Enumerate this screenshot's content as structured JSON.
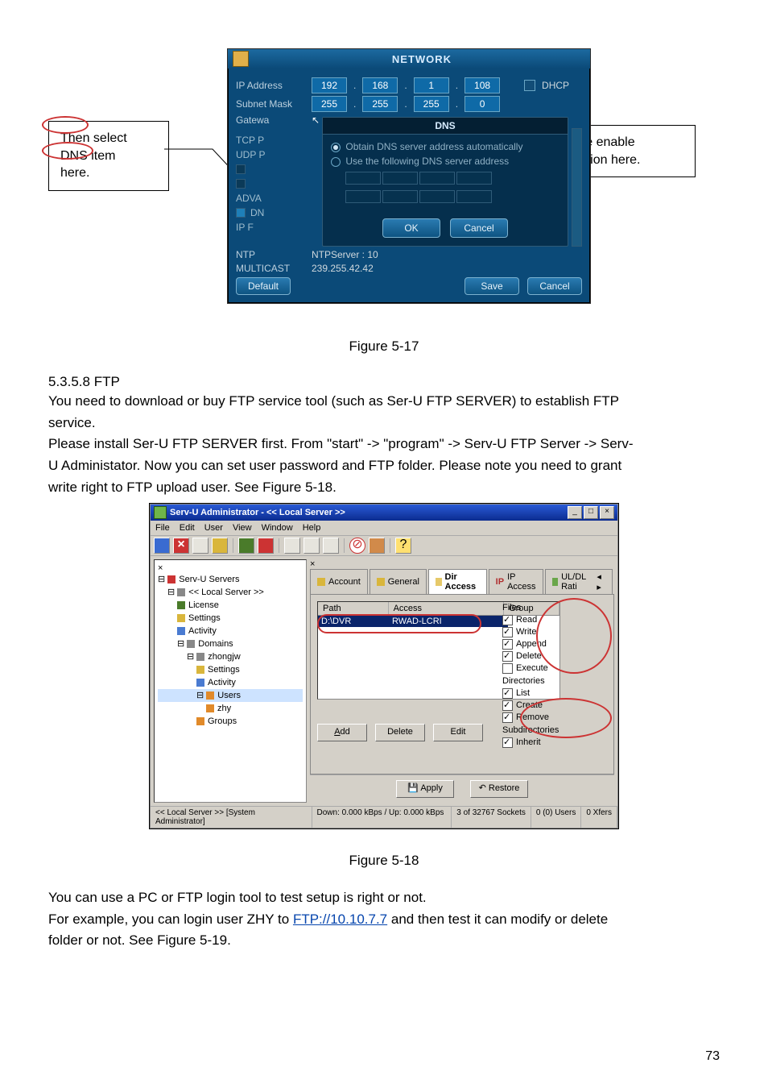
{
  "callouts": {
    "left_line1": "Then select",
    "left_line2": "DNS item",
    "left_line3": "here.",
    "right_line1": "First, please enable",
    "right_line2": "DHCP function here."
  },
  "network_window": {
    "title": "NETWORK",
    "rows": {
      "ip_label": "IP Address",
      "ip_o1": "192",
      "ip_o2": "168",
      "ip_o3": "1",
      "ip_o4": "108",
      "dhcp_label": "DHCP",
      "subnet_label": "Subnet Mask",
      "sm_o1": "255",
      "sm_o2": "255",
      "sm_o3": "255",
      "sm_o4": "0",
      "gateway_label": "Gatewa"
    },
    "dns_panel": {
      "title": "DNS",
      "opt_auto": "Obtain DNS server address automatically",
      "opt_manual": "Use the following DNS server address",
      "ok": "OK",
      "cancel": "Cancel"
    },
    "side": {
      "tcp": "TCP P",
      "udp": "UDP P",
      "adv": "ADVA",
      "dns": "DN",
      "ipf": "IP F",
      "ntp_l": "NTP",
      "ntp_v": "NTPServer : 10",
      "mc_l": "MULTICAST",
      "mc_v": "239.255.42.42"
    },
    "footer": {
      "default": "Default",
      "save": "Save",
      "cancel": "Cancel"
    }
  },
  "fig1": "Figure 5-17",
  "section": {
    "num_title": "5.3.5.8  FTP",
    "p1a": "You need to download or buy FTP service tool (such as Ser-U FTP SERVER) to establish FTP",
    "p1b": "service.",
    "p2a": "Please install Ser-U FTP SERVER first. From \"start\" -> \"program\" -> Serv-U FTP Server -> Serv-",
    "p2b": "U Administator. Now you can set user password and FTP folder. Please note you need to grant",
    "p2c": "write right to FTP upload user. See Figure 5-18."
  },
  "servu": {
    "title": "Serv-U Administrator - << Local Server >>",
    "menu": [
      "File",
      "Edit",
      "User",
      "View",
      "Window",
      "Help"
    ],
    "tree": {
      "n0": "Serv-U Servers",
      "n1": "<< Local Server >>",
      "n2": "License",
      "n3": "Settings",
      "n4": "Activity",
      "n5": "Domains",
      "n6": "zhongjw",
      "n7": "Settings",
      "n8": "Activity",
      "n9": "Users",
      "n10": "zhy",
      "n11": "Groups"
    },
    "tabs": {
      "account": "Account",
      "general": "General",
      "dir": "Dir Access",
      "ip": "IP Access",
      "ul": "UL/DL Rati"
    },
    "path_hd": {
      "path": "Path",
      "access": "Access",
      "group": "Group"
    },
    "path_row": {
      "c1": "D:\\DVR",
      "c2": "RWAD-LCRI"
    },
    "perm": {
      "files_title": "Files",
      "read": "Read",
      "write": "Write",
      "append": "Append",
      "delete": "Delete",
      "execute": "Execute",
      "dirs_title": "Directories",
      "list": "List",
      "create": "Create",
      "remove": "Remove",
      "sub_title": "Subdirectories",
      "inherit": "Inherit"
    },
    "btns": {
      "add": "Add",
      "del": "Delete",
      "edit": "Edit",
      "apply": "Apply",
      "restore": "Restore"
    },
    "status": {
      "s1": "<< Local Server >>  [System Administrator]",
      "s2": "Down: 0.000 kBps / Up: 0.000 kBps",
      "s3": "3 of 32767 Sockets",
      "s4": "0 (0) Users",
      "s5": "0 Xfers"
    }
  },
  "fig2": "Figure 5-18",
  "tail": {
    "p1": "You can use a PC or FTP login tool to test setup is right or not.",
    "p2a": "For example, you can login user ZHY to ",
    "p2link": "FTP://10.10.7.7",
    "p2b": "  and then test it can modify or delete",
    "p3": "folder or not.  See Figure 5-19."
  },
  "page_number": "73"
}
